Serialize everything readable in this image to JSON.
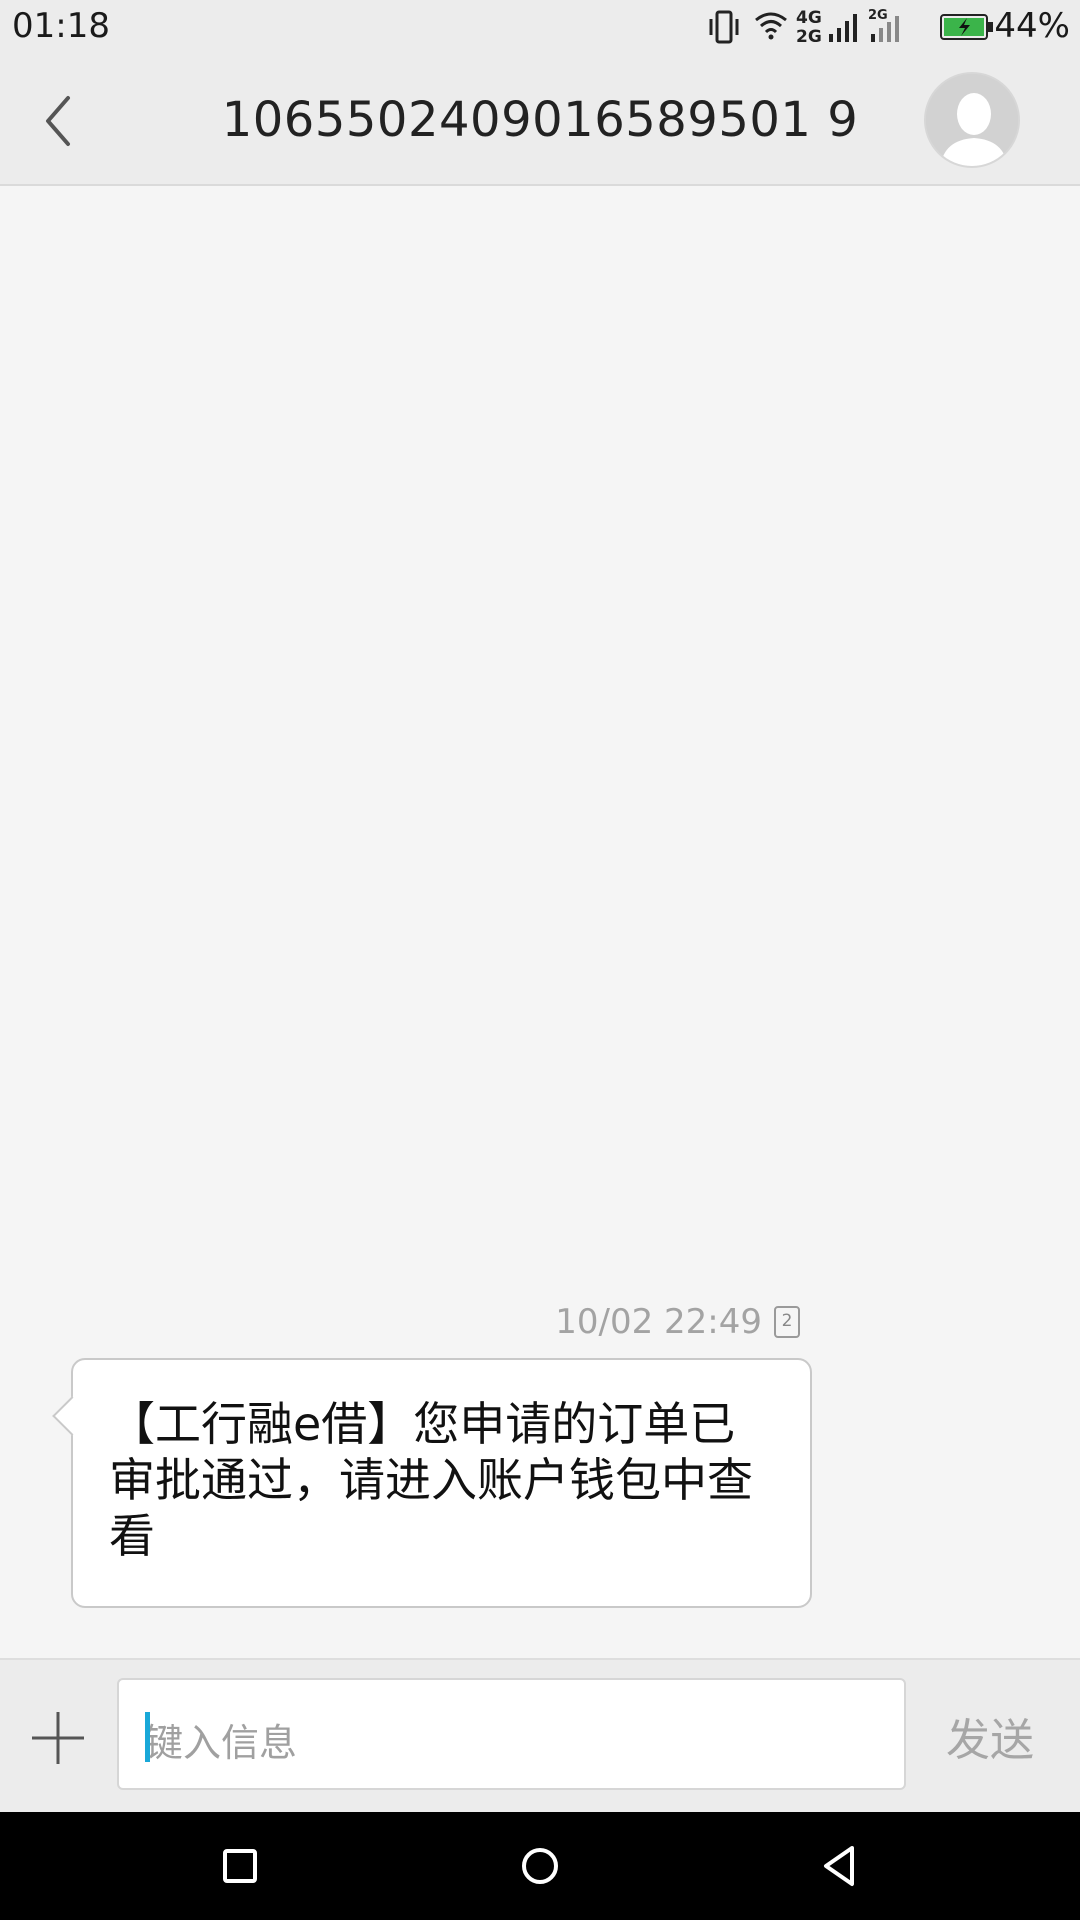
{
  "status_bar": {
    "time": "01:18",
    "net_primary": "4G",
    "net_secondary": "2G",
    "net_sim2": "2G",
    "battery_percent": "44%",
    "battery_color": "#3bb44a"
  },
  "header": {
    "title": "1065502409016589501 9"
  },
  "conversation": {
    "messages": [
      {
        "timestamp": "10/02 22:49",
        "sim_slot": "2",
        "text": "【工行融e借】您申请的订单已审批通过，请进入账户钱包中查看"
      }
    ]
  },
  "composer": {
    "placeholder": "键入信息",
    "send_label": "发送",
    "cursor_color": "#19a8d8"
  },
  "nav_bar": {
    "icons": [
      "recent-apps-icon",
      "home-icon",
      "back-icon"
    ]
  }
}
